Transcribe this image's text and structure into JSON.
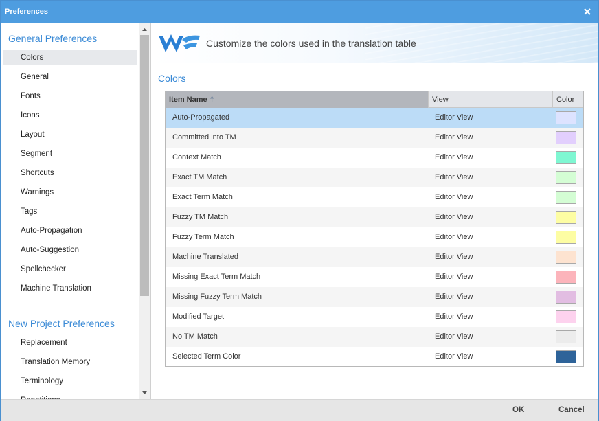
{
  "window": {
    "title": "Preferences"
  },
  "sidebar": {
    "general_title": "General Preferences",
    "general_items": [
      {
        "label": "Colors"
      },
      {
        "label": "General"
      },
      {
        "label": "Fonts"
      },
      {
        "label": "Icons"
      },
      {
        "label": "Layout"
      },
      {
        "label": "Segment"
      },
      {
        "label": "Shortcuts"
      },
      {
        "label": "Warnings"
      },
      {
        "label": "Tags"
      },
      {
        "label": "Auto-Propagation"
      },
      {
        "label": "Auto-Suggestion"
      },
      {
        "label": "Spellchecker"
      },
      {
        "label": "Machine Translation"
      }
    ],
    "project_title": "New Project Preferences",
    "project_items": [
      {
        "label": "Replacement"
      },
      {
        "label": "Translation Memory"
      },
      {
        "label": "Terminology"
      }
    ],
    "active_item": "Colors"
  },
  "banner": {
    "headline": "Customize the colors used in the translation table"
  },
  "main": {
    "heading": "Colors"
  },
  "table": {
    "columns": {
      "name": "Item Name",
      "view": "View",
      "color": "Color"
    },
    "rows": [
      {
        "name": "Auto-Propagated",
        "view": "Editor View",
        "color": "#dde3ff"
      },
      {
        "name": "Committed into TM",
        "view": "Editor View",
        "color": "#e2cffd"
      },
      {
        "name": "Context Match",
        "view": "Editor View",
        "color": "#7ff7d2"
      },
      {
        "name": "Exact TM Match",
        "view": "Editor View",
        "color": "#d4fdd4"
      },
      {
        "name": "Exact Term Match",
        "view": "Editor View",
        "color": "#d4fdd4"
      },
      {
        "name": "Fuzzy TM Match",
        "view": "Editor View",
        "color": "#fdfda3"
      },
      {
        "name": "Fuzzy Term Match",
        "view": "Editor View",
        "color": "#fdfda3"
      },
      {
        "name": "Machine Translated",
        "view": "Editor View",
        "color": "#fde3d0"
      },
      {
        "name": "Missing Exact Term Match",
        "view": "Editor View",
        "color": "#fcb4bb"
      },
      {
        "name": "Missing Fuzzy Term Match",
        "view": "Editor View",
        "color": "#e2bde2"
      },
      {
        "name": "Modified Target",
        "view": "Editor View",
        "color": "#fdd2ee"
      },
      {
        "name": "No TM Match",
        "view": "Editor View",
        "color": "#ececec"
      },
      {
        "name": "Selected Term Color",
        "view": "Editor View",
        "color": "#2e6399"
      }
    ],
    "selected_row": "Auto-Propagated"
  },
  "footer": {
    "ok_label": "OK",
    "cancel_label": "Cancel"
  },
  "colors": {
    "accent": "#3a8ad6",
    "titlebar": "#4e9de0",
    "selection": "#bcdcf7"
  }
}
